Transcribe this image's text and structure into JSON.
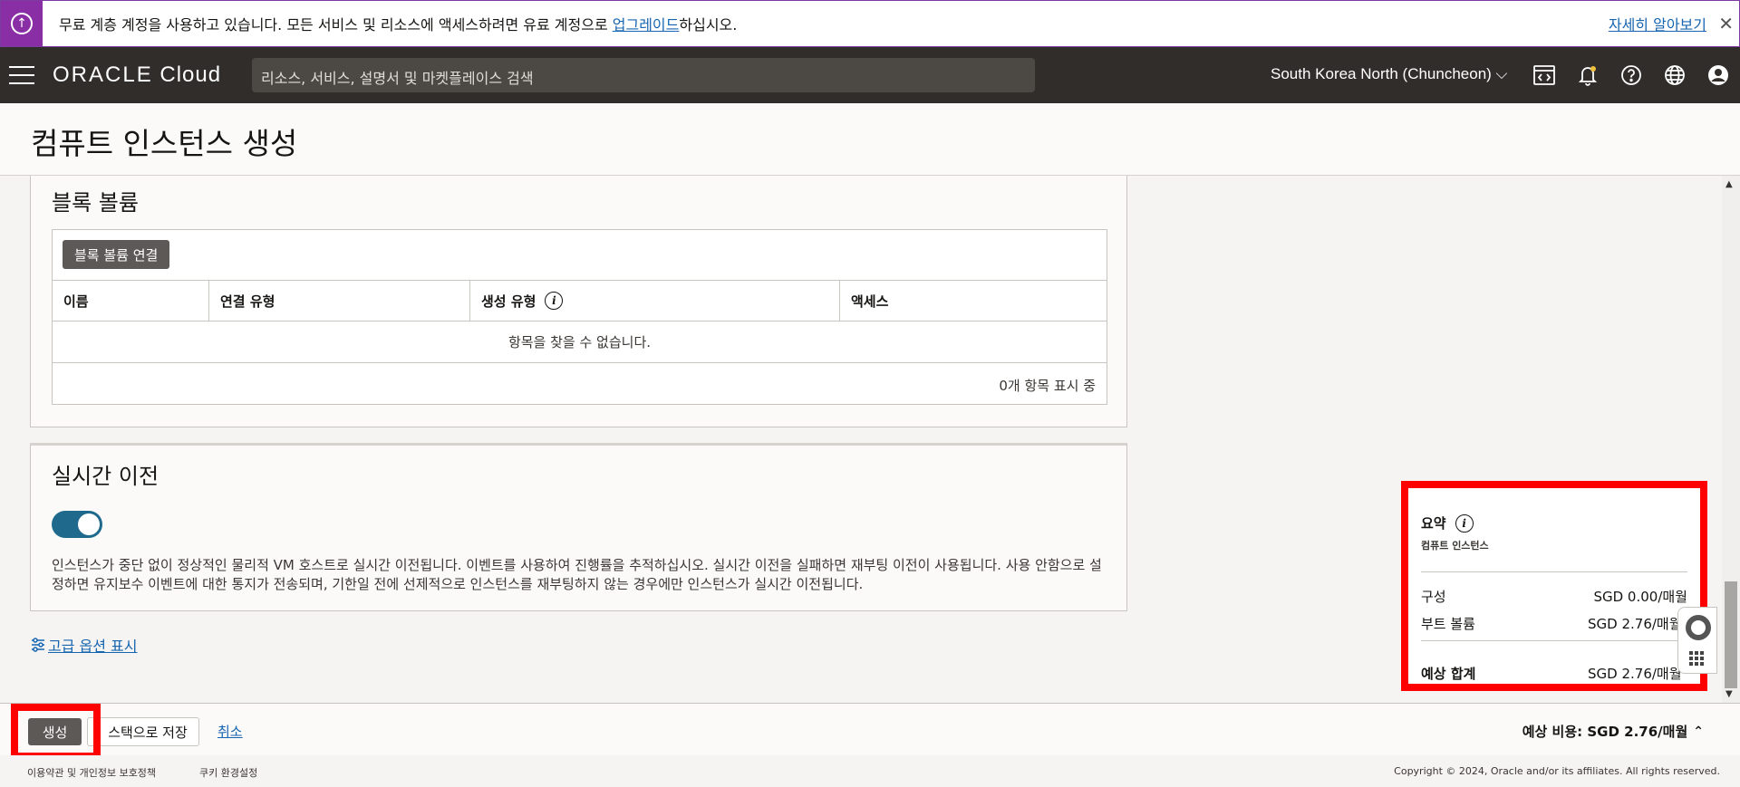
{
  "banner": {
    "text_before": "무료 계층 계정을 사용하고 있습니다. 모든 서비스 및 리소스에 액세스하려면 유료 계정으로 ",
    "upgrade_link": "업그레이드",
    "text_after": "하십시오.",
    "more_link": "자세히 알아보기",
    "close_glyph": "✕",
    "icon_glyph": "↑"
  },
  "header": {
    "logo_bold": "ORACLE",
    "logo_light": " Cloud",
    "search_placeholder": "리소스, 서비스, 설명서 및 마켓플레이스 검색",
    "region": "South Korea North (Chuncheon)",
    "region_chevron": "⌵"
  },
  "page": {
    "title": "컴퓨트 인스턴스 생성"
  },
  "block_volume": {
    "title": "블록 볼륨",
    "attach_button": "블록 볼륨 연결",
    "columns": [
      "이름",
      "연결 유형",
      "생성 유형",
      "액세스"
    ],
    "empty_message": "항목을 찾을 수 없습니다.",
    "count_text": "0개 항목 표시 중"
  },
  "live_migration": {
    "title": "실시간 이전",
    "toggle_on": true,
    "description": "인스턴스가 중단 없이 정상적인 물리적 VM 호스트로 실시간 이전됩니다. 이벤트를 사용하여 진행률을 추적하십시오. 실시간 이전을 실패하면 재부팅 이전이 사용됩니다. 사용 안함으로 설정하면 유지보수 이벤트에 대한 통지가 전송되며, 기한일 전에 선제적으로 인스턴스를 재부팅하지 않는 경우에만 인스턴스가 실시간 이전됩니다."
  },
  "advanced_link": "고급 옵션 표시",
  "summary": {
    "title": "요약",
    "subtitle": "컴퓨트 인스턴스",
    "rows": [
      {
        "label": "구성",
        "value": "SGD 0.00/매월"
      },
      {
        "label": "부트 볼륨",
        "value": "SGD 2.76/매월"
      }
    ],
    "total_label": "예상 합계",
    "total_value": "SGD 2.76/매월"
  },
  "actions": {
    "create": "생성",
    "save_stack": "스택으로 저장",
    "cancel": "취소",
    "estimated_cost": "예상 비용: SGD 2.76/매월",
    "estimated_chevron": "⌃"
  },
  "footer": {
    "terms": "이용약관 및 개인정보 보호정책",
    "cookies": "쿠키 환경설정",
    "copyright": "Copyright © 2024, Oracle and/or its affiliates. All rights reserved."
  },
  "colors": {
    "banner_accent": "#8a2ea5",
    "header_bg": "#312d2a",
    "primary_button": "#5c5956",
    "link": "#1765b0",
    "toggle_on": "#1f6a8c",
    "highlight": "#ff0000"
  }
}
